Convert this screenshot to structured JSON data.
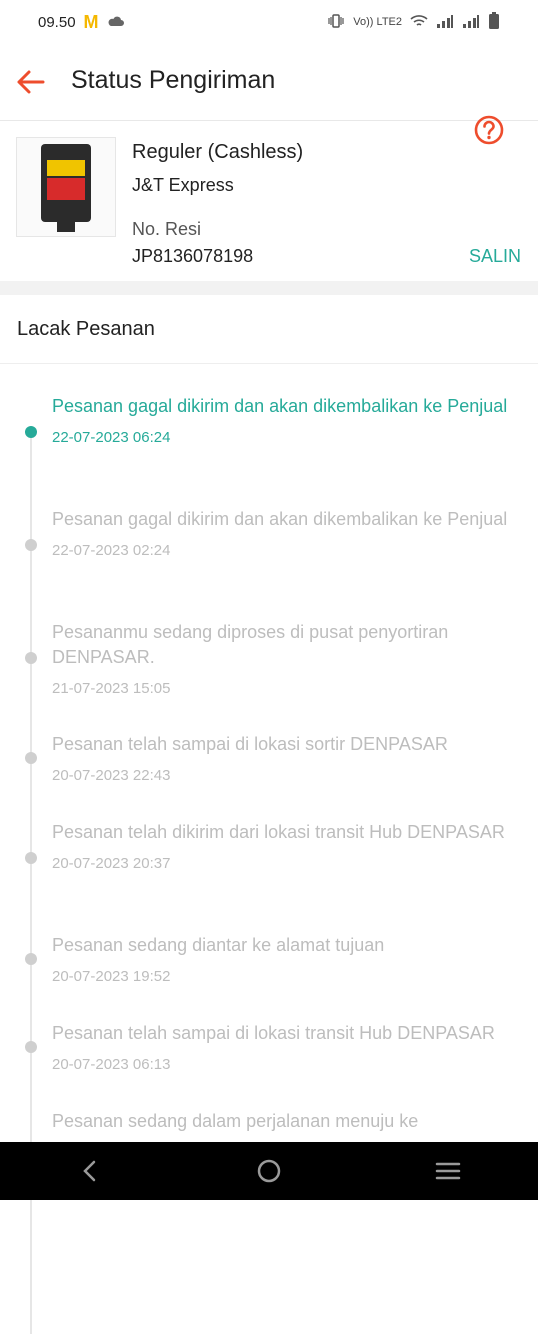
{
  "status_bar": {
    "time": "09.50",
    "network": "Vo)) LTE2"
  },
  "header": {
    "title": "Status Pengiriman"
  },
  "colors": {
    "accent_orange": "#ee4d2d",
    "accent_teal": "#26aa99"
  },
  "shipment": {
    "service": "Reguler (Cashless)",
    "courier": "J&T Express",
    "resi_label": "No. Resi",
    "resi_number": "JP8136078198",
    "copy_label": "SALIN"
  },
  "tracking": {
    "title": "Lacak Pesanan",
    "events": [
      {
        "text": "Pesanan gagal dikirim dan akan dikembalikan ke Penjual",
        "time": "22-07-2023 06:24",
        "active": true
      },
      {
        "text": "Pesanan gagal dikirim dan akan dikembalikan ke Penjual",
        "time": "22-07-2023 02:24"
      },
      {
        "text": "Pesananmu sedang diproses di pusat penyortiran DENPASAR.",
        "time": "21-07-2023 15:05"
      },
      {
        "text": "Pesanan telah sampai di lokasi sortir DENPASAR",
        "time": "20-07-2023 22:43"
      },
      {
        "text": "Pesanan telah dikirim dari lokasi transit Hub DENPASAR",
        "time": "20-07-2023 20:37"
      },
      {
        "text": "Pesanan sedang diantar ke alamat tujuan",
        "time": "20-07-2023 19:52"
      },
      {
        "text": "Pesanan telah sampai di lokasi transit Hub DENPASAR",
        "time": "20-07-2023 06:13"
      },
      {
        "text": "Pesanan sedang dalam perjalanan menuju ke",
        "time": ""
      }
    ]
  },
  "icons": {
    "back": "arrow-left-icon",
    "help": "question-circle-icon",
    "nav_back": "chevron-left-icon",
    "nav_home": "circle-icon",
    "nav_menu": "hamburger-icon"
  }
}
